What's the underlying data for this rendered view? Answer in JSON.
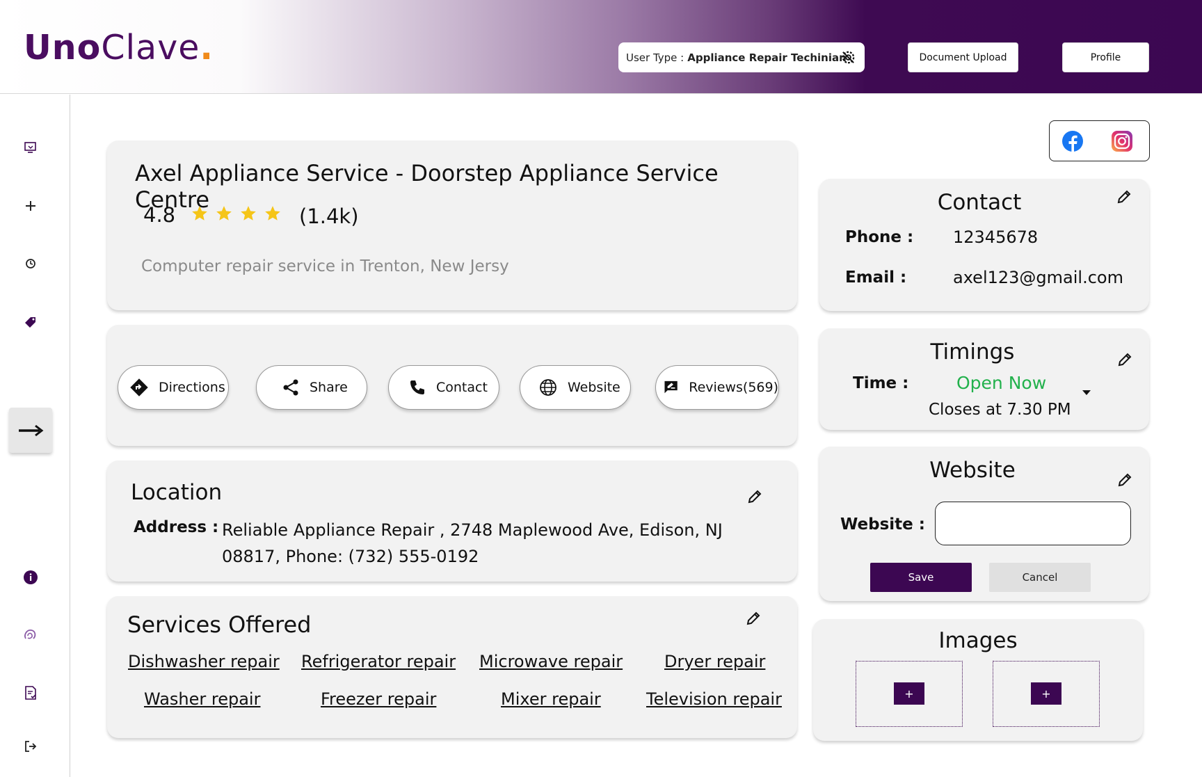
{
  "brand": {
    "logo_uno": "Uno",
    "logo_clave": "Clave",
    "logo_dot": "."
  },
  "header": {
    "user_type_label": "User Type :",
    "user_type_value": "Appliance Repair Techinian",
    "document_upload": "Document Upload",
    "profile": "Profile"
  },
  "business": {
    "title": "Axel Appliance Service - Doorstep Appliance Service Centre",
    "rating": "4.8",
    "stars": 4,
    "review_count": "(1.4k)",
    "description": "Computer repair service in Trenton, New Jersy"
  },
  "actions": [
    {
      "label": "Directions",
      "icon": "directions-icon"
    },
    {
      "label": "Share",
      "icon": "share-icon"
    },
    {
      "label": "Contact",
      "icon": "phone-icon"
    },
    {
      "label": "Website",
      "icon": "globe-icon"
    },
    {
      "label": "Reviews(569)",
      "icon": "reviews-icon"
    }
  ],
  "location": {
    "title": "Location",
    "address_label": "Address :",
    "address_value": "Reliable Appliance Repair , 2748 Maplewood Ave,  Edison, NJ 08817, Phone: (732) 555-0192"
  },
  "services": {
    "title": "Services Offered",
    "items": [
      "Dishwasher repair",
      "Refrigerator repair",
      "Microwave repair",
      "Dryer repair",
      "Washer repair",
      "Freezer repair",
      "Mixer repair",
      "Television repair"
    ]
  },
  "contact": {
    "title": "Contact",
    "phone_label": "Phone :",
    "phone_value": "12345678",
    "email_label": "Email :",
    "email_value": "axel123@gmail.com"
  },
  "timings": {
    "title": "Timings",
    "time_label": "Time :",
    "status": "Open Now",
    "closes": "Closes at 7.30 PM"
  },
  "website": {
    "title": "Website",
    "label": "Website :",
    "value": "",
    "save": "Save",
    "cancel": "Cancel"
  },
  "images": {
    "title": "Images",
    "add": "+"
  },
  "colors": {
    "brand": "#3c0752",
    "accent": "#f08a1a",
    "open": "#22b14c",
    "star": "#f5c518"
  }
}
